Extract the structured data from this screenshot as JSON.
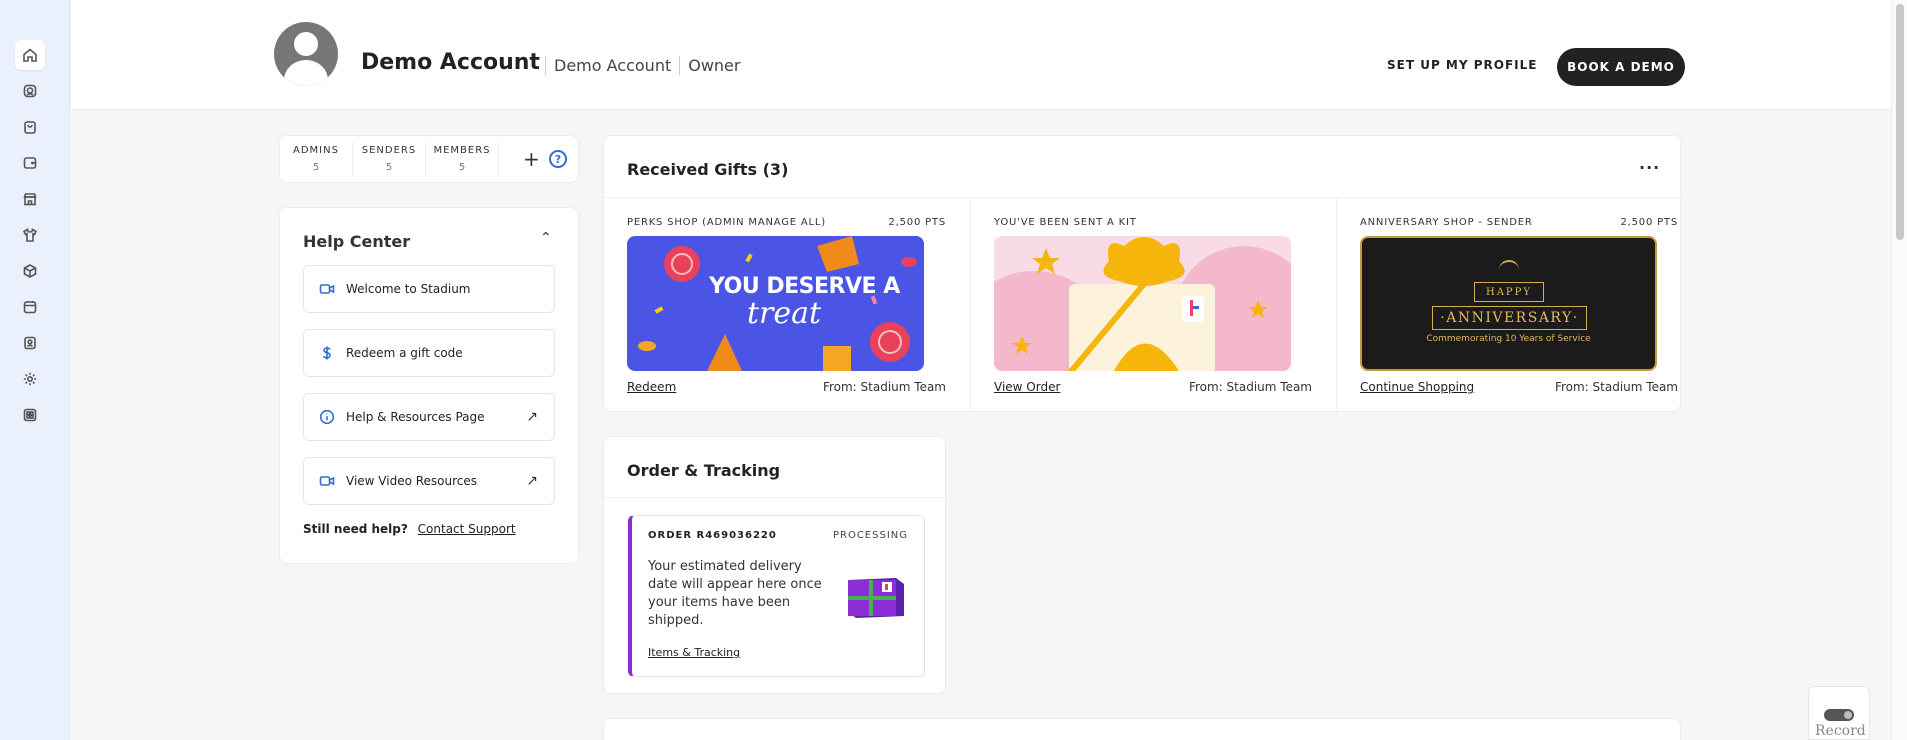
{
  "sidebar": {
    "expand_glyph": "›",
    "items": [
      {
        "icon": "home-icon",
        "active": true
      },
      {
        "icon": "gift-icon",
        "active": false
      },
      {
        "icon": "bag-icon",
        "active": false
      },
      {
        "icon": "wallet-icon",
        "active": false
      },
      {
        "icon": "store-icon",
        "active": false
      },
      {
        "icon": "shirt-icon",
        "active": false
      },
      {
        "icon": "box-icon",
        "active": false
      },
      {
        "icon": "calendar-icon",
        "active": false
      },
      {
        "icon": "contacts-icon",
        "active": false
      },
      {
        "icon": "gear-icon",
        "active": false
      },
      {
        "icon": "apps-icon",
        "active": false
      }
    ]
  },
  "header": {
    "account_name": "Demo Account",
    "account_org": "Demo Account",
    "account_role": "Owner",
    "setup_label": "SET UP MY PROFILE",
    "book_label": "BOOK A DEMO"
  },
  "team": {
    "admins_label": "ADMINS",
    "admins_count": "5",
    "senders_label": "SENDERS",
    "senders_count": "5",
    "members_label": "MEMBERS",
    "members_count": "5",
    "add_glyph": "+",
    "help_glyph": "?"
  },
  "help_center": {
    "title": "Help Center",
    "items": [
      {
        "label": "Welcome to Stadium",
        "icon": "video-icon"
      },
      {
        "label": "Redeem a gift code",
        "icon": "dollar-icon"
      },
      {
        "label": "Help & Resources Page",
        "icon": "info-icon"
      },
      {
        "label": "View Video Resources",
        "icon": "video-icon"
      }
    ],
    "still_need": "Still need help?",
    "contact": "Contact Support"
  },
  "gifts": {
    "title": "Received Gifts (3)",
    "more": "···",
    "items": [
      {
        "shop": "PERKS SHOP (ADMIN MANAGE ALL)",
        "pts": "2,500 PTS",
        "action": "Redeem",
        "from": "From: Stadium Team",
        "img_line1": "YOU DESERVE A",
        "img_line2": "treat"
      },
      {
        "shop": "YOU'VE BEEN SENT A KIT",
        "pts": "",
        "action": "View Order",
        "from": "From: Stadium Team"
      },
      {
        "shop": "ANNIVERSARY SHOP - SENDER",
        "pts": "2,500 PTS",
        "action": "Continue Shopping",
        "from": "From: Stadium Team",
        "img_happy": "HAPPY",
        "img_main": "·ANNIVERSARY·",
        "img_sub": "Commemorating 10 Years of Service"
      }
    ]
  },
  "order": {
    "title": "Order & Tracking",
    "number": "ORDER R469036220",
    "status": "PROCESSING",
    "text": "Your estimated delivery date will appear here once your items have been shipped.",
    "link": "Items & Tracking"
  },
  "record": {
    "label": "Record"
  },
  "colors": {
    "accent": "#2c6fd6",
    "order_border": "#8a2fd6",
    "sidebar_bg": "#eaf1fd"
  }
}
